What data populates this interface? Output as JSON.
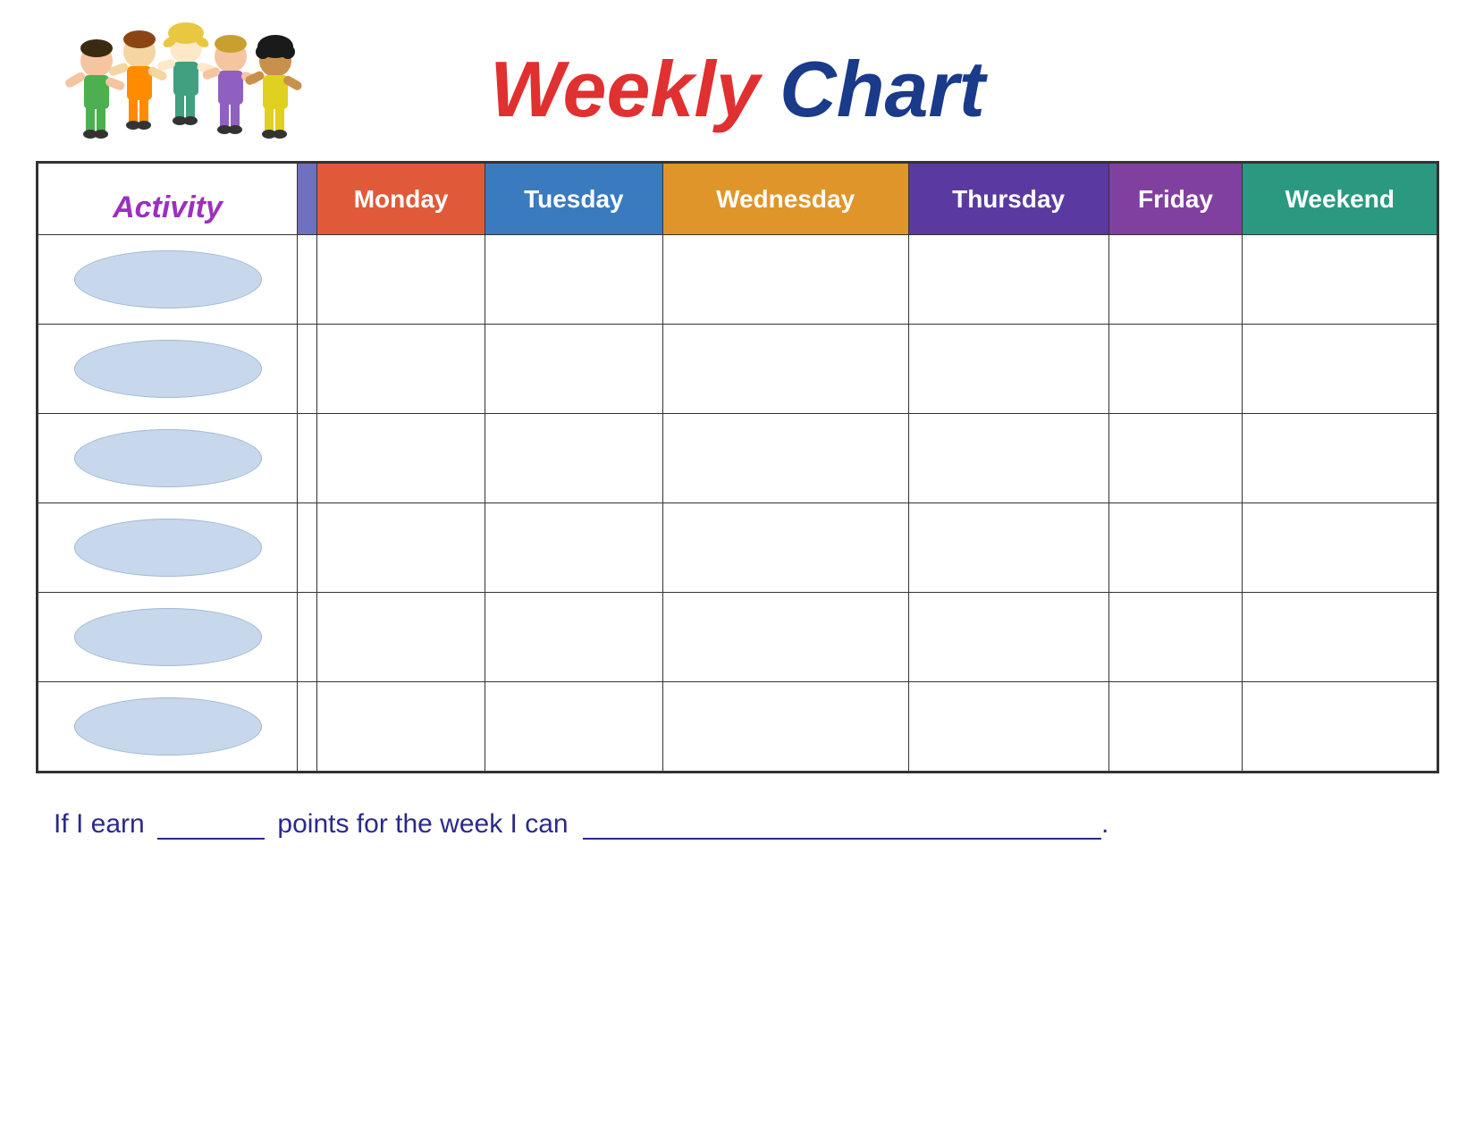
{
  "title": {
    "weekly": "Weekly",
    "chart": "Chart"
  },
  "activity_label": "Activity",
  "days": {
    "monday": "Monday",
    "tuesday": "Tuesday",
    "wednesday": "Wednesday",
    "thursday": "Thursday",
    "friday": "Friday",
    "weekend": "Weekend"
  },
  "rows": [
    {
      "id": 1
    },
    {
      "id": 2
    },
    {
      "id": 3
    },
    {
      "id": 4
    },
    {
      "id": 5
    },
    {
      "id": 6
    }
  ],
  "footer": {
    "text_before_blank1": "If I earn",
    "text_before_blank2": "points for the week I can",
    "period": "."
  },
  "colors": {
    "monday": "#e05a3a",
    "tuesday": "#3a7abf",
    "wednesday": "#e0952a",
    "thursday": "#5a3aa0",
    "friday": "#8040a0",
    "weekend": "#2a9980",
    "activity_label": "#9b30c0",
    "divider": "#7070c0",
    "title_weekly": "#e03030",
    "title_chart": "#1a3a8a"
  }
}
